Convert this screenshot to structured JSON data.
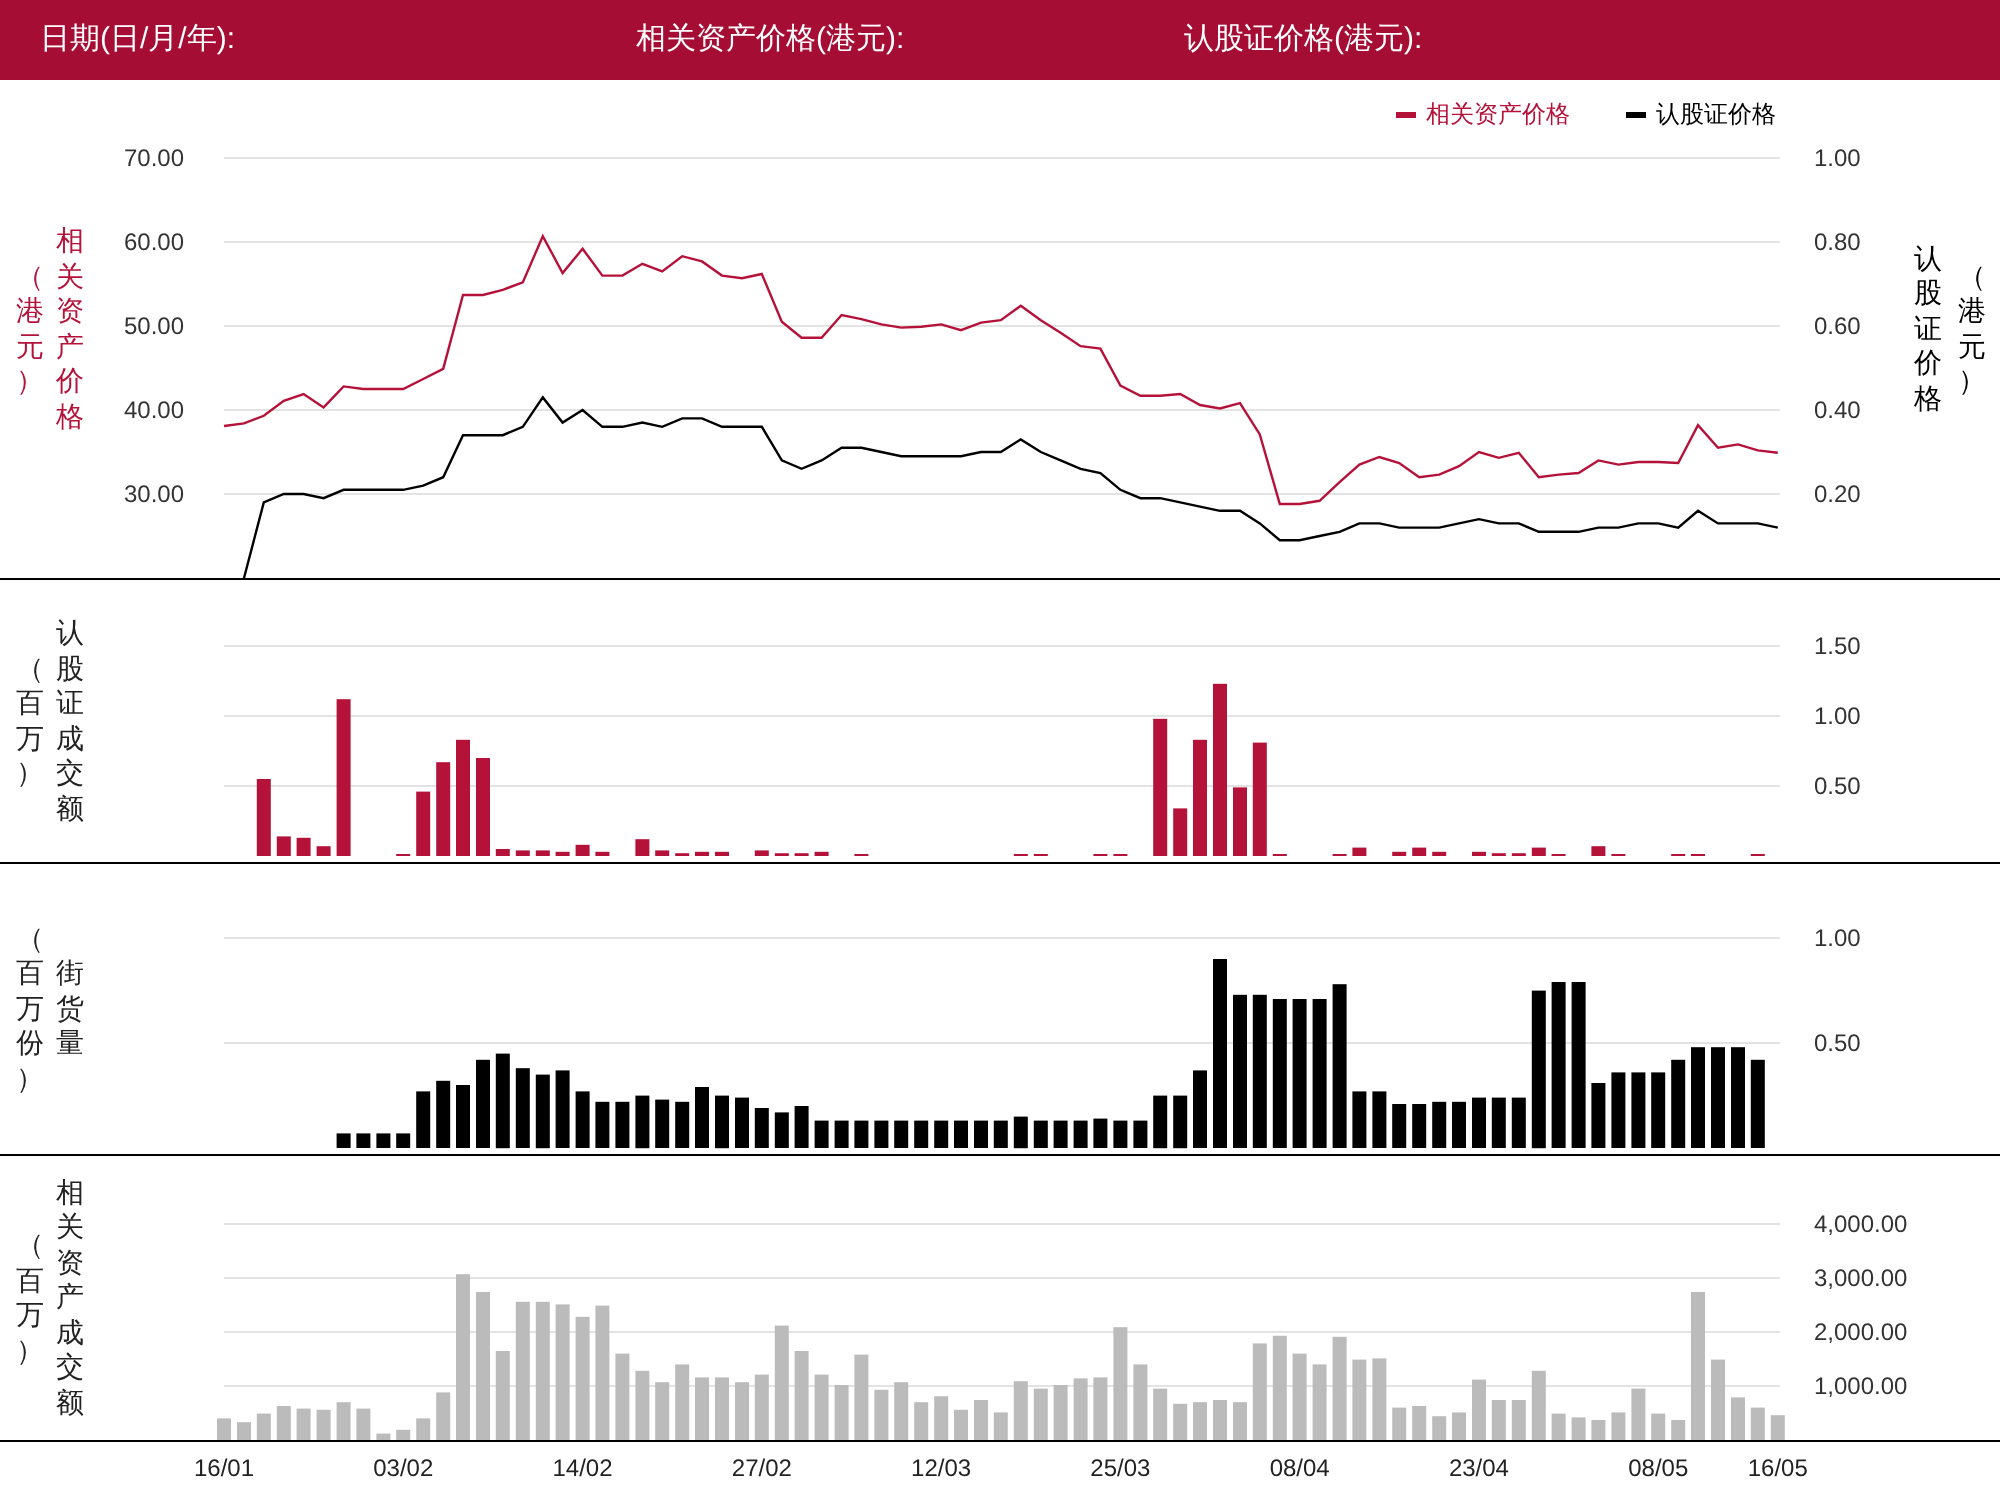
{
  "header": {
    "fields": [
      "日期(日/月/年):",
      "相关资产价格(港元):",
      "认股证价格(港元):"
    ]
  },
  "panels": [
    {
      "left_title": "相关资产价格",
      "left_unit": "（港元）",
      "right_title": "认股证价格",
      "right_unit": "（港元）",
      "chart_data": {
        "type": "line",
        "grid": true,
        "legend": true,
        "ylim": [
          20,
          70
        ],
        "yticks": [
          {
            "value": 30,
            "label": "30.00"
          },
          {
            "value": 40,
            "label": "40.00"
          },
          {
            "value": 50,
            "label": "50.00"
          },
          {
            "value": 60,
            "label": "60.00"
          },
          {
            "value": 70,
            "label": "70.00"
          }
        ],
        "y2lim": [
          0,
          1
        ],
        "y2ticks": [
          {
            "value": 0.2,
            "label": "0.20"
          },
          {
            "value": 0.4,
            "label": "0.40"
          },
          {
            "value": 0.6,
            "label": "0.60"
          },
          {
            "value": 0.8,
            "label": "0.80"
          },
          {
            "value": 1,
            "label": "1.00"
          }
        ],
        "series": [
          {
            "name": "相关资产价格",
            "color": "#b5123a",
            "values": [
              38.1,
              38.4,
              39.3,
              41.1,
              41.9,
              40.3,
              42.8,
              42.5,
              42.5,
              42.5,
              43.7,
              44.9,
              53.7,
              53.7,
              54.3,
              55.2,
              60.7,
              56.3,
              59.2,
              56.0,
              56.0,
              57.4,
              56.5,
              58.3,
              57.7,
              56.0,
              55.7,
              56.2,
              50.5,
              48.6,
              48.6,
              51.3,
              50.8,
              50.2,
              49.8,
              49.9,
              50.2,
              49.5,
              50.4,
              50.7,
              52.4,
              50.7,
              49.2,
              47.6,
              47.3,
              42.9,
              41.7,
              41.7,
              41.9,
              40.6,
              40.2,
              40.8,
              37.1,
              28.8,
              28.8,
              29.2,
              31.4,
              33.5,
              34.4,
              33.7,
              32.0,
              32.3,
              33.3,
              35.0,
              34.3,
              34.9,
              32.0,
              32.3,
              32.5,
              34.0,
              33.5,
              33.8,
              33.8,
              33.7,
              38.2,
              35.5,
              35.9,
              35.2,
              34.9
            ]
          },
          {
            "name": "认股证价格",
            "color": "#000000",
            "axis": "y2",
            "values": [
              null,
              0.0,
              0.18,
              0.2,
              0.2,
              0.19,
              0.21,
              0.21,
              0.21,
              0.21,
              0.22,
              0.24,
              0.34,
              0.34,
              0.34,
              0.36,
              0.43,
              0.37,
              0.4,
              0.36,
              0.36,
              0.37,
              0.36,
              0.38,
              0.38,
              0.36,
              0.36,
              0.36,
              0.28,
              0.26,
              0.28,
              0.31,
              0.31,
              0.3,
              0.29,
              0.29,
              0.29,
              0.29,
              0.3,
              0.3,
              0.33,
              0.3,
              0.28,
              0.26,
              0.25,
              0.21,
              0.19,
              0.19,
              0.18,
              0.17,
              0.16,
              0.16,
              0.13,
              0.09,
              0.09,
              0.1,
              0.11,
              0.13,
              0.13,
              0.12,
              0.12,
              0.12,
              0.13,
              0.14,
              0.13,
              0.13,
              0.11,
              0.11,
              0.11,
              0.12,
              0.12,
              0.13,
              0.13,
              0.12,
              0.16,
              0.13,
              0.13,
              0.13,
              0.12
            ]
          }
        ]
      }
    },
    {
      "left_title": "认股证成交额",
      "left_unit": "（百万）",
      "chart_data": {
        "type": "bar",
        "grid": true,
        "y2lim": [
          0,
          1.5
        ],
        "y2ticks": [
          {
            "value": 0.5,
            "label": "0.50"
          },
          {
            "value": 1,
            "label": "1.00"
          },
          {
            "value": 1.5,
            "label": "1.50"
          }
        ],
        "series": [
          {
            "color": "#b5123a",
            "axis": "y2",
            "values": [
              null,
              null,
              0.55,
              0.14,
              0.13,
              0.07,
              1.12,
              null,
              null,
              0.01,
              0.46,
              0.67,
              0.83,
              0.7,
              0.05,
              0.04,
              0.04,
              0.03,
              0.08,
              0.03,
              null,
              0.12,
              0.04,
              0.02,
              0.03,
              0.03,
              null,
              0.04,
              0.02,
              0.02,
              0.03,
              null,
              0.01,
              null,
              null,
              null,
              null,
              null,
              null,
              null,
              0.01,
              0.01,
              null,
              null,
              0.01,
              0.01,
              null,
              0.98,
              0.34,
              0.83,
              1.23,
              0.49,
              0.81,
              0.01,
              null,
              null,
              0.01,
              0.06,
              null,
              0.03,
              0.06,
              0.03,
              null,
              0.03,
              0.02,
              0.02,
              0.06,
              0.01,
              null,
              0.07,
              0.01,
              null,
              null,
              0.01,
              0.01,
              null,
              null,
              0.01,
              null
            ]
          }
        ]
      }
    },
    {
      "left_title": "街货量",
      "left_unit": "（百万份）",
      "chart_data": {
        "type": "bar",
        "grid": true,
        "y2lim": [
          0,
          1
        ],
        "y2ticks": [
          {
            "value": 0.5,
            "label": "0.50"
          },
          {
            "value": 1,
            "label": "1.00"
          }
        ],
        "series": [
          {
            "color": "#000000",
            "axis": "y2",
            "values": [
              null,
              null,
              null,
              null,
              null,
              null,
              0.07,
              0.07,
              0.07,
              0.07,
              0.27,
              0.32,
              0.3,
              0.42,
              0.45,
              0.38,
              0.35,
              0.37,
              0.27,
              0.22,
              0.22,
              0.25,
              0.23,
              0.22,
              0.29,
              0.25,
              0.24,
              0.19,
              0.17,
              0.2,
              0.13,
              0.13,
              0.13,
              0.13,
              0.13,
              0.13,
              0.13,
              0.13,
              0.13,
              0.13,
              0.15,
              0.13,
              0.13,
              0.13,
              0.14,
              0.13,
              0.13,
              0.25,
              0.25,
              0.37,
              0.9,
              0.73,
              0.73,
              0.71,
              0.71,
              0.71,
              0.78,
              0.27,
              0.27,
              0.21,
              0.21,
              0.22,
              0.22,
              0.24,
              0.24,
              0.24,
              0.75,
              0.79,
              0.79,
              0.31,
              0.36,
              0.36,
              0.36,
              0.42,
              0.48,
              0.48,
              0.48,
              0.42,
              null
            ]
          }
        ]
      }
    },
    {
      "left_title": "相关资产成交额",
      "left_unit": "（百万）",
      "chart_data": {
        "type": "bar",
        "y2lim": [
          0,
          4000
        ],
        "y2ticks": [
          {
            "value": 1000,
            "label": "1,000.00"
          },
          {
            "value": 2000,
            "label": "2,000.00"
          },
          {
            "value": 3000,
            "label": "3,000.00"
          },
          {
            "value": 4000,
            "label": "4,000.00"
          }
        ],
        "grid": true,
        "categories": [
          "16/01",
          null,
          null,
          null,
          null,
          null,
          null,
          null,
          null,
          "03/02",
          null,
          null,
          null,
          null,
          null,
          null,
          null,
          null,
          "14/02",
          null,
          null,
          null,
          null,
          null,
          null,
          null,
          null,
          "27/02",
          null,
          null,
          null,
          null,
          null,
          null,
          null,
          null,
          "12/03",
          null,
          null,
          null,
          null,
          null,
          null,
          null,
          null,
          "25/03",
          null,
          null,
          null,
          null,
          null,
          null,
          null,
          null,
          "08/04",
          null,
          null,
          null,
          null,
          null,
          null,
          null,
          null,
          "23/04",
          null,
          null,
          null,
          null,
          null,
          null,
          null,
          null,
          "08/05",
          null,
          null,
          null,
          null,
          null,
          "16/05"
        ],
        "series": [
          {
            "color": "#bbbbbb",
            "axis": "y2",
            "values": [
              400,
              330,
              490,
              630,
              580,
              560,
              700,
              580,
              120,
              190,
              400,
              880,
              3070,
              2740,
              1650,
              2560,
              2560,
              2510,
              2280,
              2490,
              1600,
              1280,
              1070,
              1400,
              1160,
              1160,
              1070,
              1210,
              2120,
              1650,
              1210,
              1020,
              1580,
              930,
              1070,
              700,
              810,
              560,
              740,
              510,
              1090,
              950,
              1020,
              1140,
              1160,
              2090,
              1400,
              950,
              670,
              700,
              740,
              700,
              1790,
              1930,
              1600,
              1400,
              1910,
              1490,
              1510,
              600,
              630,
              440,
              510,
              1120,
              740,
              740,
              1280,
              490,
              420,
              370,
              510,
              950,
              490,
              370,
              2740,
              1490,
              790,
              600,
              460
            ]
          }
        ]
      }
    }
  ]
}
